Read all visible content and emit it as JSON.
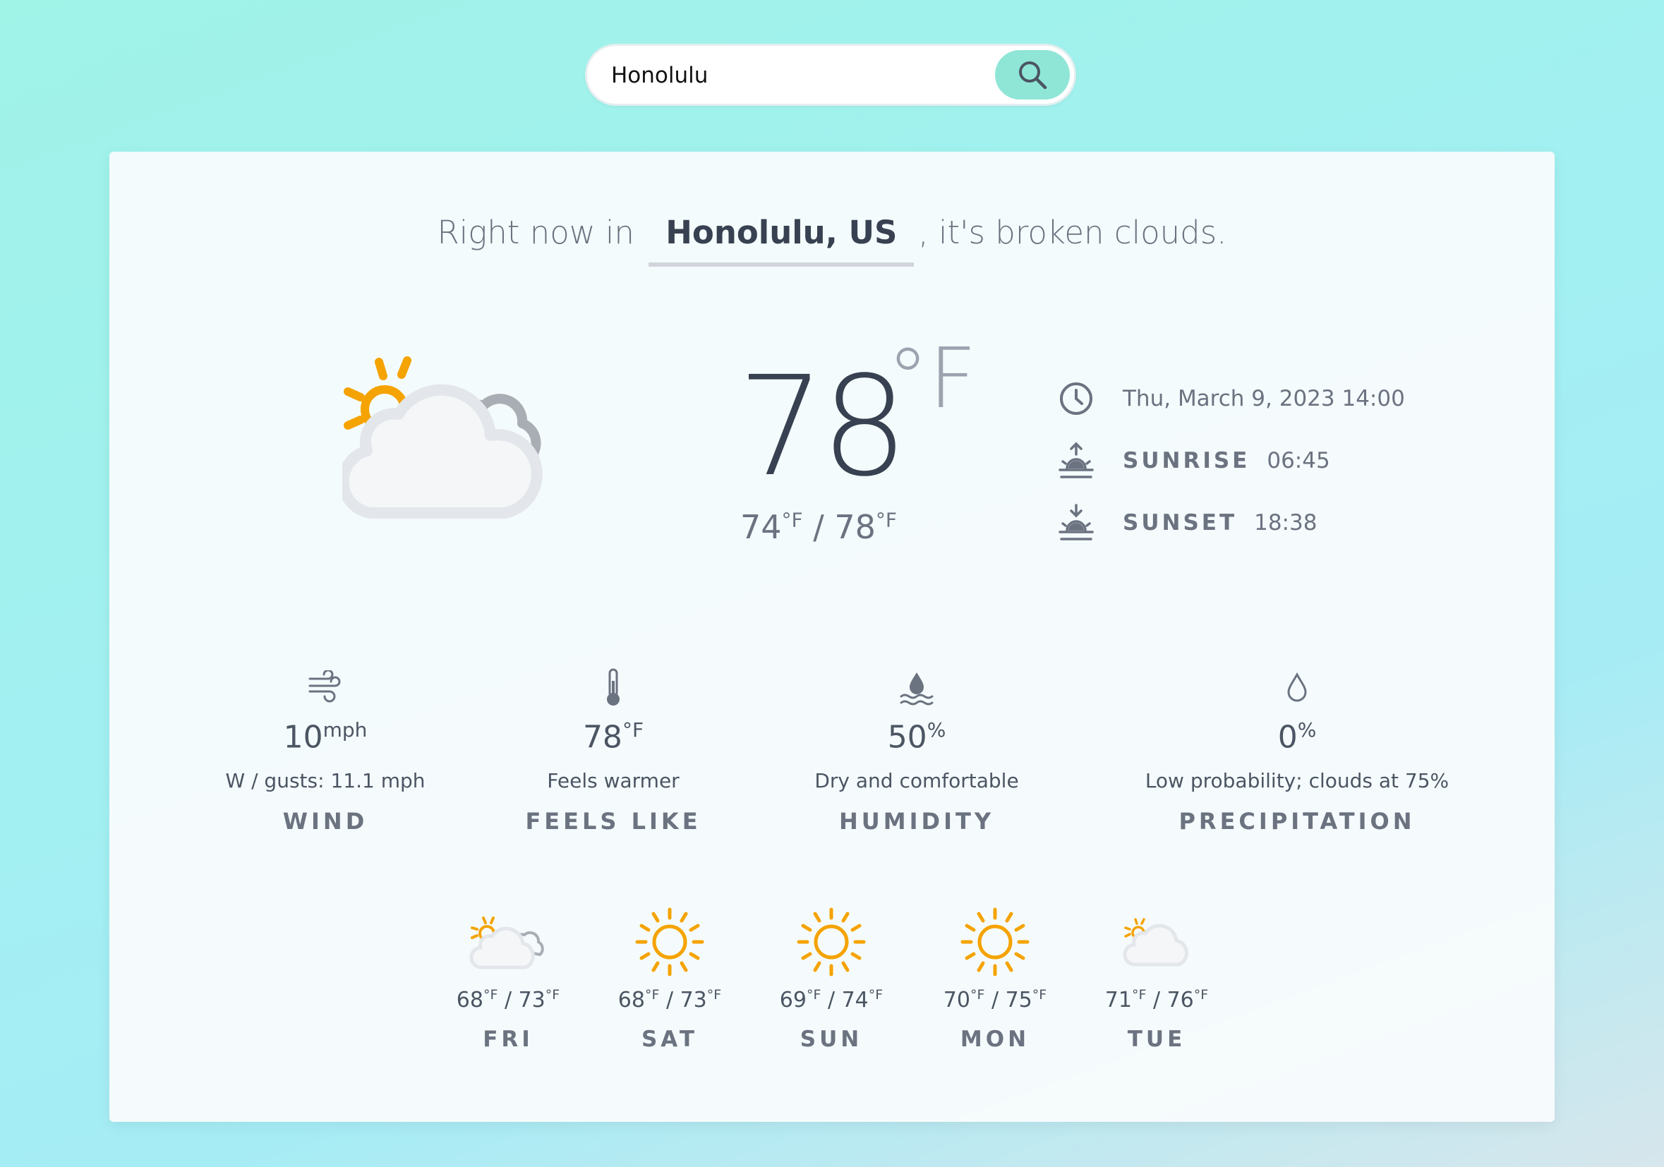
{
  "search": {
    "value": "Honolulu",
    "button_icon": "search-icon"
  },
  "headline": {
    "prefix": "Right now in",
    "city": "Honolulu, US",
    "suffix": ", it's broken clouds."
  },
  "current": {
    "icon": "sun-behind-cloud-icon",
    "temp": "78",
    "unit": "°F",
    "low": "74",
    "high": "78",
    "hilo_unit": "°F",
    "separator": "/"
  },
  "info": {
    "datetime": "Thu, March 9, 2023 14:00",
    "sunrise_label": "SUNRISE",
    "sunrise_time": "06:45",
    "sunset_label": "SUNSET",
    "sunset_time": "18:38"
  },
  "stats": [
    {
      "icon": "wind-icon",
      "value": "10",
      "unit": "mph",
      "desc": "W / gusts: 11.1 mph",
      "name": "WIND"
    },
    {
      "icon": "thermometer-icon",
      "value": "78",
      "unit": "°F",
      "desc": "Feels warmer",
      "name": "FEELS LIKE"
    },
    {
      "icon": "humidity-icon",
      "value": "50",
      "unit": "%",
      "desc": "Dry and comfortable",
      "name": "HUMIDITY"
    },
    {
      "icon": "raindrop-icon",
      "value": "0",
      "unit": "%",
      "desc": "Low probability; clouds at 75%",
      "name": "PRECIPITATION"
    }
  ],
  "forecast": [
    {
      "day": "FRI",
      "low": "68",
      "high": "73",
      "unit": "°F",
      "icon": "partly-cloudy-icon"
    },
    {
      "day": "SAT",
      "low": "68",
      "high": "73",
      "unit": "°F",
      "icon": "sun-icon"
    },
    {
      "day": "SUN",
      "low": "69",
      "high": "74",
      "unit": "°F",
      "icon": "sun-icon"
    },
    {
      "day": "MON",
      "low": "70",
      "high": "75",
      "unit": "°F",
      "icon": "sun-icon"
    },
    {
      "day": "TUE",
      "low": "71",
      "high": "76",
      "unit": "°F",
      "icon": "cloudy-icon"
    }
  ],
  "colors": {
    "sun": "#f5a300",
    "cloud": "#e3e6ea",
    "cloud_back": "#a9adb4",
    "accent": "#8fe6d6"
  }
}
